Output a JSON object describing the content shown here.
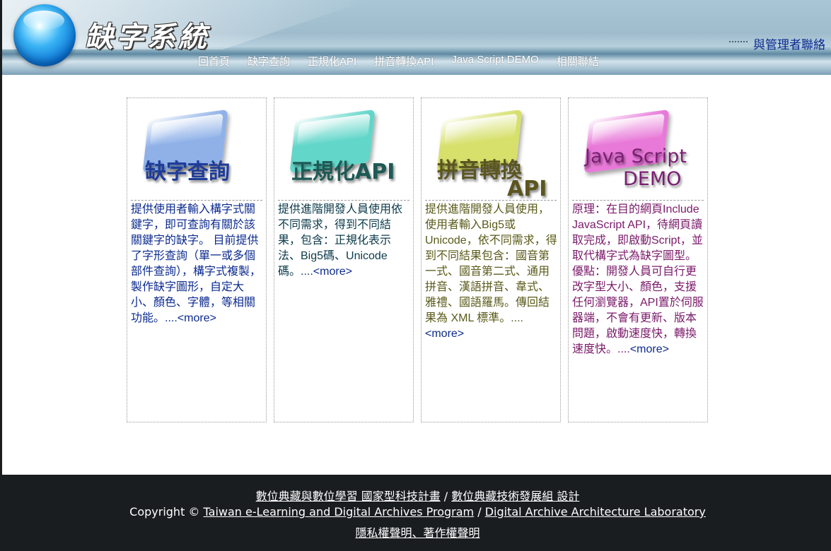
{
  "header": {
    "title": "缺字系統",
    "contact_link": "與管理者聯絡"
  },
  "nav": {
    "items": [
      {
        "label": "回首頁"
      },
      {
        "label": "缺字查詢"
      },
      {
        "label": "正規化API"
      },
      {
        "label": "拼音轉換API"
      },
      {
        "label": "Java Script DEMO"
      },
      {
        "label": "相關聯結"
      }
    ]
  },
  "cards": [
    {
      "banner_line1": "缺字查詢",
      "banner_line2": "",
      "glass_color": "#8fb1e8",
      "text_color": "#0b2a8f",
      "description": "提供使用者輸入構字式關鍵字，即可查詢有關於該關鍵字的缺字。 目前提供了字形查詢（單一或多個部件查詢），構字式複製，製作缺字圖形，自定大小、顏色、字體，等相關功能。....",
      "more": "<more>"
    },
    {
      "banner_line1": "正規化API",
      "banner_line2": "",
      "glass_color": "#62d6c9",
      "text_color": "#0b3a4a",
      "description": "提供進階開發人員使用依不同需求，得到不同結果，包含：正規化表示法、Big5碼、Unicode碼。....",
      "more": "<more>"
    },
    {
      "banner_line1": "拼音轉換",
      "banner_line2": "API",
      "glass_color": "#d6e06a",
      "text_color": "#5a5a1a",
      "description": "提供進階開發人員使用，使用者輸入Big5或Unicode，依不同需求，得到不同結果包含：國音第一式、國音第二式、通用拼音、漢語拼音、韋式、雅禮、國語羅馬。傳回結果為 XML 標準。....",
      "more": "<more>"
    },
    {
      "banner_line1": "Java Script",
      "banner_line2": "DEMO",
      "glass_color": "#e879d8",
      "text_color": "#7a1a6a",
      "description": "原理：在目的網頁Include JavaScript API，待網頁讀取完成，即啟動Script，並取代構字式為缺字圖型。優點：開發人員可自行更改字型大小、顏色，支援任何瀏覽器，API置於伺服器端，不會有更新、版本問題，啟動速度快，轉換速度快。....",
      "more": "<more>"
    }
  ],
  "footer": {
    "line1_a": "數位典藏與數位學習 國家型科技計畫",
    "line1_sep": " / ",
    "line1_b": "數位典藏技術發展組 設計",
    "line2_prefix": "Copyright © ",
    "line2_a": "Taiwan e-Learning and Digital Archives Program",
    "line2_sep": " / ",
    "line2_b": "Digital Archive Architecture Laboratory",
    "line3": "隱私權聲明、著作權聲明"
  }
}
